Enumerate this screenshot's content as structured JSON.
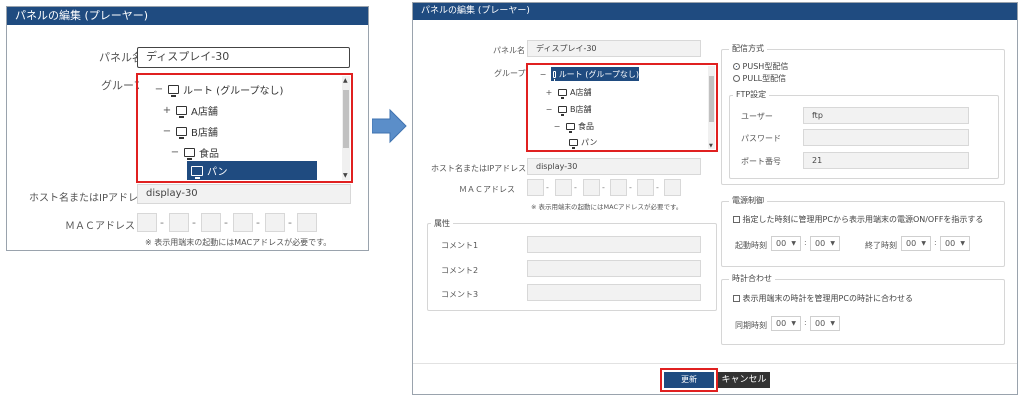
{
  "dialog_title": "パネルの編集 (プレーヤー)",
  "labels": {
    "panel_name": "パネル名",
    "group": "グループ",
    "host": "ホスト名またはIPアドレス",
    "mac": "ＭＡＣアドレス",
    "mac_note": "※ 表示用端末の起動にはMACアドレスが必要です。",
    "dash": "-",
    "colon": ":"
  },
  "values": {
    "panel_name": "ディスプレイ-30",
    "host": "display-30"
  },
  "tree": [
    {
      "toggle": "−",
      "label": "ルート (グループなし)"
    },
    {
      "toggle": "+",
      "label": "A店舗"
    },
    {
      "toggle": "−",
      "label": "B店舗"
    },
    {
      "toggle": "−",
      "label": "食品"
    },
    {
      "toggle": "",
      "label": "パン"
    }
  ],
  "attributes": {
    "title": "属性",
    "comment1": "コメント1",
    "comment2": "コメント2",
    "comment3": "コメント3"
  },
  "delivery": {
    "title": "配信方式",
    "push": "PUSH型配信",
    "pull": "PULL型配信",
    "selected": "push",
    "ftp_title": "FTP設定",
    "user_label": "ユーザー",
    "user_value": "ftp",
    "password_label": "パスワード",
    "port_label": "ポート番号",
    "port_value": "21"
  },
  "power": {
    "title": "電源制御",
    "checkbox": "指定した時刻に管理用PCから表示用端末の電源ON/OFFを指示する",
    "start_label": "起動時刻",
    "end_label": "終了時刻",
    "start_h": "00",
    "start_m": "00",
    "end_h": "00",
    "end_m": "00"
  },
  "clock": {
    "title": "時計合わせ",
    "checkbox": "表示用端末の時計を管理用PCの時計に合わせる",
    "sync_label": "同期時刻",
    "sync_h": "00",
    "sync_m": "00"
  },
  "buttons": {
    "update": "更新",
    "cancel": "キャンセル"
  },
  "colors": {
    "title_bar": "#1f4b80",
    "selection": "#1f4b80",
    "highlight": "#e02020",
    "arrow": "#5b8ec9",
    "cancel_bg": "#333333"
  }
}
